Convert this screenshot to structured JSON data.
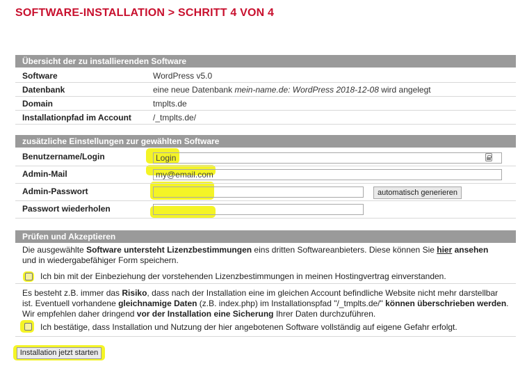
{
  "page": {
    "title": "SOFTWARE-INSTALLATION > SCHRITT 4 VON 4"
  },
  "overview": {
    "header": "Übersicht der zu installierenden Software",
    "rows": [
      {
        "label": "Software",
        "value": "WordPress v5.0"
      },
      {
        "label": "Datenbank",
        "value_prefix": "eine neue Datenbank ",
        "value_em": "mein-name.de: WordPress 2018-12-08",
        "value_suffix": " wird angelegt"
      },
      {
        "label": "Domain",
        "value": "tmplts.de"
      },
      {
        "label": "Installationpfad im Account",
        "value": "/_tmplts.de/"
      }
    ]
  },
  "settings": {
    "header": "zusätzliche Einstellungen zur gewählten Software",
    "fields": {
      "username": {
        "label": "Benutzername/Login",
        "value": "Login"
      },
      "email": {
        "label": "Admin-Mail",
        "value": "my@email.com"
      },
      "password": {
        "label": "Admin-Passwort",
        "value": ""
      },
      "password_repeat": {
        "label": "Passwort wiederholen",
        "value": ""
      }
    },
    "generate_button": "automatisch generieren"
  },
  "accept": {
    "header": "Prüfen und Akzeptieren",
    "license_text": {
      "p1": "Die ausgewählte ",
      "b1": "Software untersteht Lizenzbestimmungen",
      "p2": " eins dritten Softwareanbieters. Diese können Sie ",
      "link": "hier",
      "b2": "ansehen",
      "p3": "und in wiedergabefähiger Form speichern."
    },
    "checkbox1_label": "Ich bin mit der Einbeziehung der vorstehenden Lizenzbestimmungen in meinen Hostingvertrag einverstanden.",
    "risk_text": {
      "p1": "Es besteht z.B. immer das ",
      "b1": "Risiko",
      "p2": ", dass nach der Installation eine im gleichen Account befindliche Website nicht mehr darstellbar ist. Eventuell vorhandene ",
      "b2": "gleichnamige Daten",
      "p3": " (z.B. index.php) im Installationspfad \"/_tmplts.de/\" ",
      "b3": "können überschrieben werden",
      "p4": ". Wir empfehlen daher dringend ",
      "b4": "vor der Installation eine Sicherung",
      "p5": " Ihrer Daten durchzuführen."
    },
    "checkbox2_label": "Ich bestätige, dass Installation und Nutzung der hier angebotenen Software vollständig auf eigene Gefahr erfolgt."
  },
  "start_button": "Installation jetzt starten",
  "colors": {
    "title": "#c8102e",
    "header_bg": "#9a9a9a",
    "highlight": "#f2f200"
  }
}
